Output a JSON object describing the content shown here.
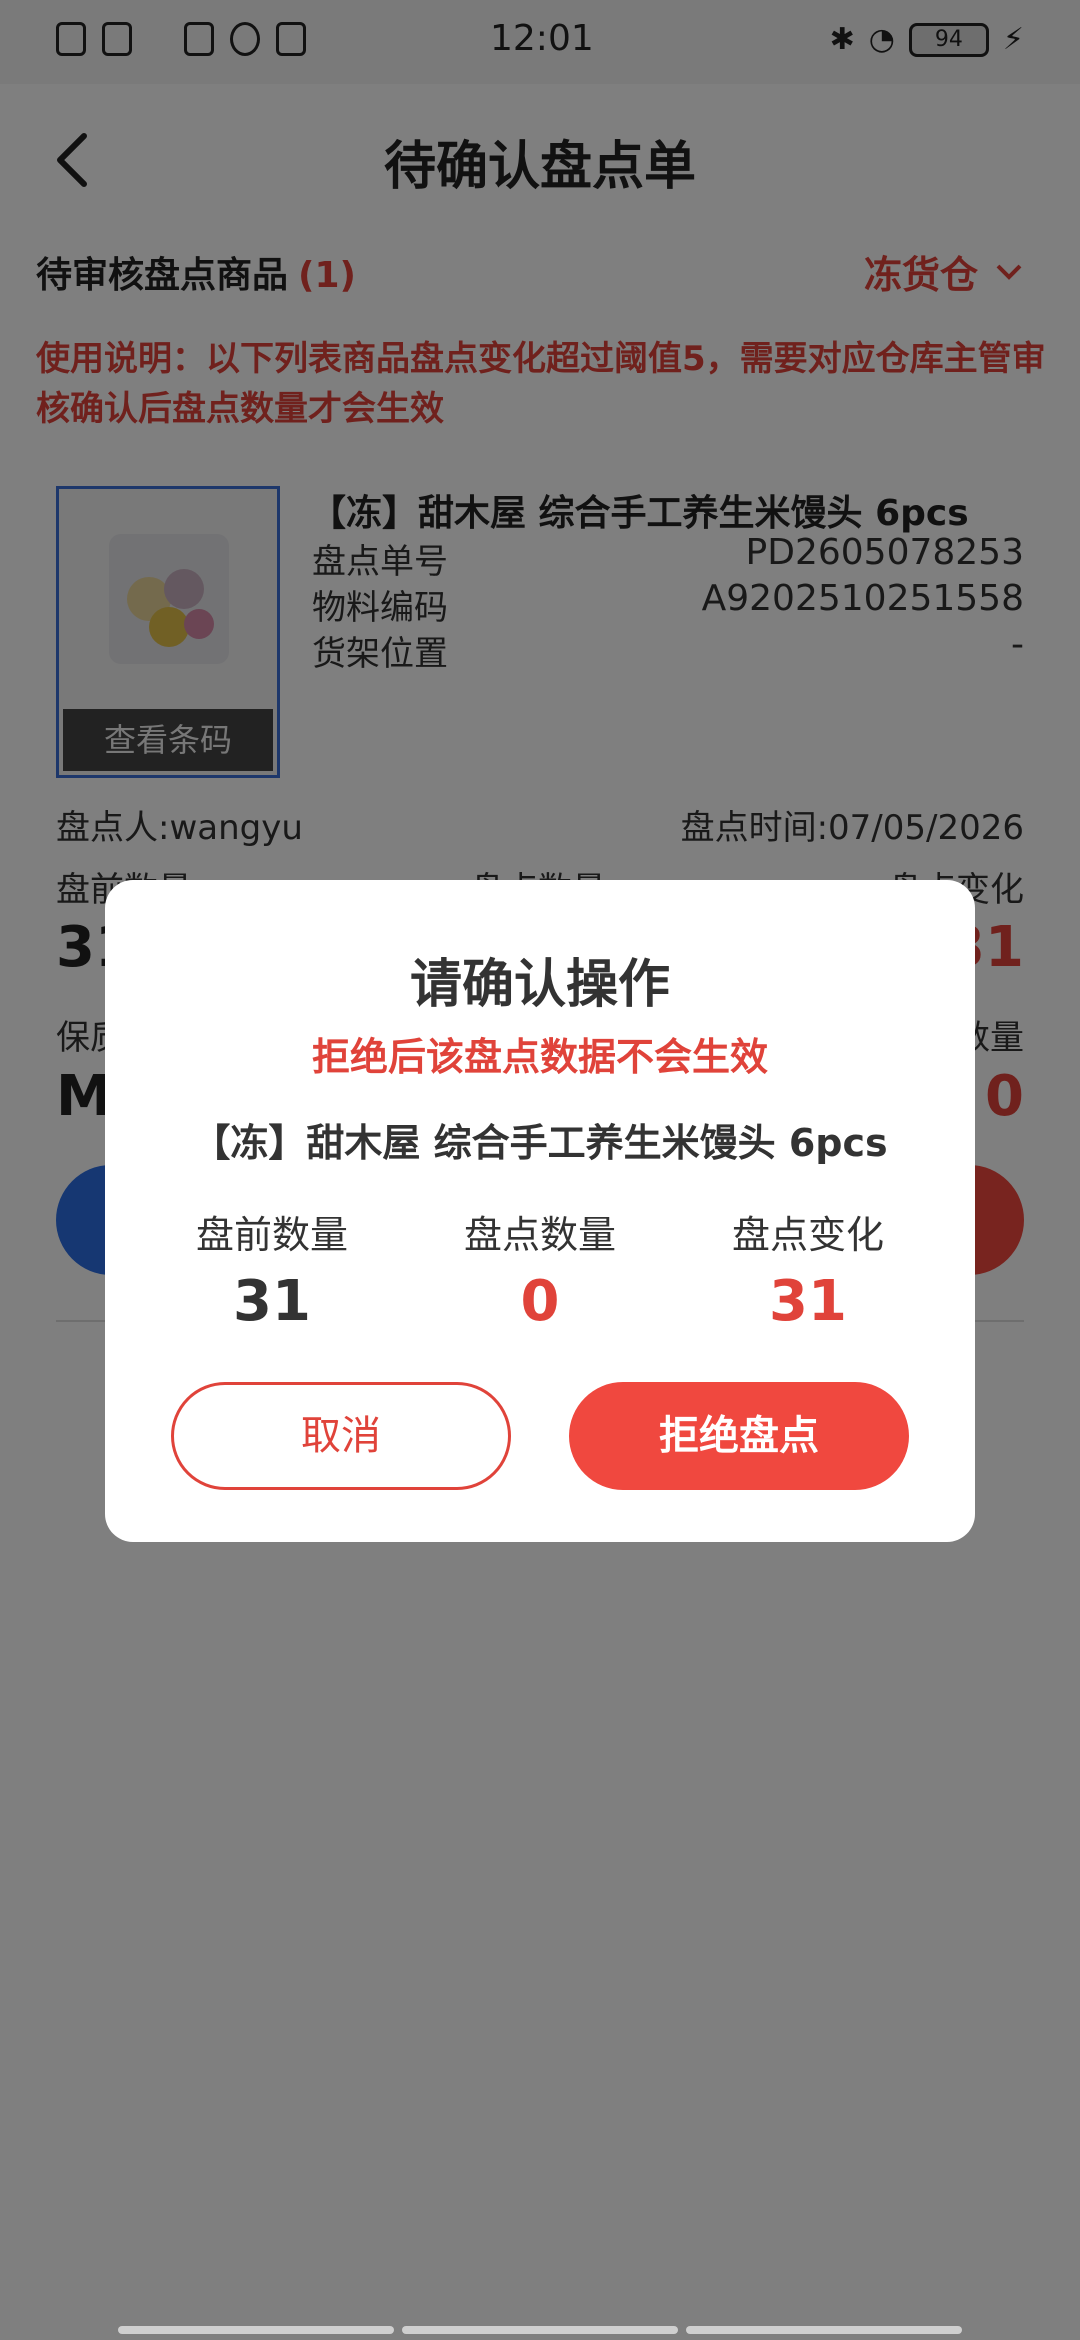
{
  "status_bar": {
    "time": "12:01",
    "battery": "94"
  },
  "header": {
    "title": "待确认盘点单"
  },
  "pending": {
    "title": "待审核盘点商品",
    "count": "(1)"
  },
  "warehouse": {
    "selected": "冻货仓"
  },
  "instructions": "使用说明：以下列表商品盘点变化超过阈值5，需要对应仓库主管审核确认后盘点数量才会生效",
  "product": {
    "name": "【冻】甜木屋 综合手工养生米馒头 6pcs",
    "barcode_button": "查看条码",
    "rows": [
      {
        "label": "盘点单号",
        "value": "PD2605078253"
      },
      {
        "label": "物料编码",
        "value": "A9202510251558"
      },
      {
        "label": "货架位置",
        "value": "-"
      }
    ],
    "counter": "盘点人:wangyu",
    "count_time": "盘点时间:07/05/2026",
    "col_before_label": "盘前数量",
    "col_count_label": "盘点数量",
    "col_change_label": "盘点变化",
    "before_value_partial": "31",
    "change_value_partial": "31",
    "shelf_label_partial": "保质",
    "shelf_value_partial": "M",
    "qty_label_partial": "数量",
    "qty_value_partial": "0"
  },
  "dialog": {
    "title": "请确认操作",
    "warning": "拒绝后该盘点数据不会生效",
    "product_name": "【冻】甜木屋 综合手工养生米馒头 6pcs",
    "before_label": "盘前数量",
    "before_value": "31",
    "count_label": "盘点数量",
    "count_value": "0",
    "change_label": "盘点变化",
    "change_value": "31",
    "cancel_label": "取消",
    "reject_label": "拒绝盘点"
  },
  "colors": {
    "accent_red": "#e0433a",
    "primary_blue": "#2d6ee5"
  }
}
